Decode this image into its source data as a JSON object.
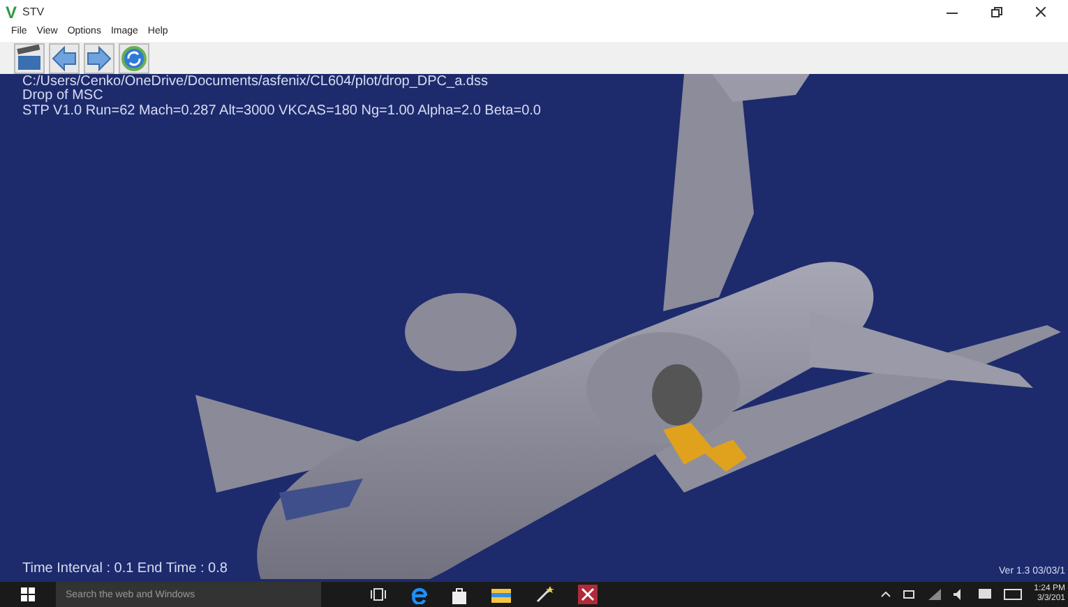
{
  "window": {
    "logo": "V",
    "title": "STV"
  },
  "menu": [
    "File",
    "View",
    "Options",
    "Image",
    "Help"
  ],
  "toolbar": [
    {
      "kind": "clapper"
    },
    {
      "kind": "back"
    },
    {
      "kind": "forward"
    },
    {
      "kind": "refresh"
    }
  ],
  "viewport": {
    "path": "C:/Users/Cenko/OneDrive/Documents/asfenix/CL604/plot/drop_DPC_a.dss",
    "case": "Drop of MSC",
    "params": "STP V1.0  Run=62 Mach=0.287 Alt=3000 VKCAS=180 Ng=1.00 Alpha=2.0 Beta=0.0",
    "time": "Time Interval : 0.1  End Time : 0.8",
    "version": "Ver 1.3 03/03/1"
  },
  "taskbar": {
    "search_placeholder": "Search the web and Windows",
    "apps": [
      {
        "kind": "taskview"
      },
      {
        "kind": "edge"
      },
      {
        "kind": "store"
      },
      {
        "kind": "explorer"
      },
      {
        "kind": "wand"
      },
      {
        "kind": "app"
      }
    ],
    "time": "1:24 PM",
    "date": "3/3/201"
  }
}
